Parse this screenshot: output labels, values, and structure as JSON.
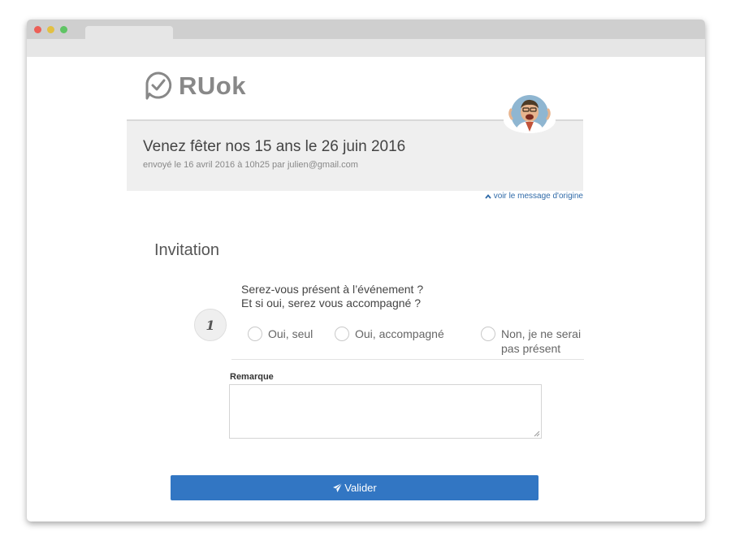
{
  "brand": {
    "name": "RUok"
  },
  "message": {
    "title": "Venez fêter nos 15 ans le 26 juin 2016",
    "meta": "envoyé le 16 avril 2016 à 10h25 par julien@gmail.com",
    "origin_link": "voir le message d'origine"
  },
  "section": {
    "title": "Invitation"
  },
  "question": {
    "number": "1",
    "line1": "Serez-vous présent à l’événement ?",
    "line2": "Et si oui, serez vous accompagné ?",
    "options": [
      {
        "label": "Oui, seul"
      },
      {
        "label": "Oui, accompagné"
      },
      {
        "label": "Non, je ne serai pas présent"
      }
    ]
  },
  "remark": {
    "label": "Remarque",
    "value": ""
  },
  "submit": {
    "label": "Valider"
  },
  "colors": {
    "accent": "#3276c3",
    "link": "#2f6aa8",
    "panel": "#efefef"
  }
}
